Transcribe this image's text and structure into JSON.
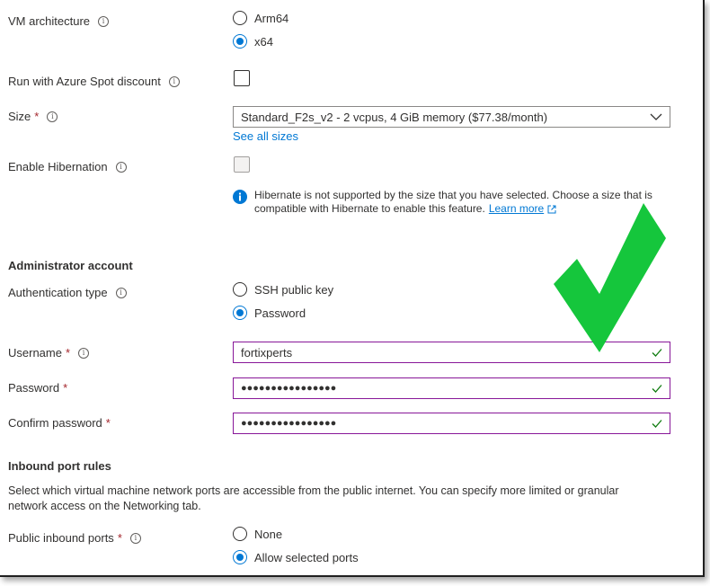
{
  "vm_architecture": {
    "label": "VM architecture",
    "options": [
      "Arm64",
      "x64"
    ],
    "selected": "x64"
  },
  "spot": {
    "label": "Run with Azure Spot discount",
    "checked": false
  },
  "size": {
    "label": "Size",
    "required_mark": "*",
    "value": "Standard_F2s_v2 - 2 vcpus, 4 GiB memory ($77.38/month)",
    "see_all_link": "See all sizes"
  },
  "hibernation": {
    "label": "Enable Hibernation",
    "checked": false,
    "disabled": true,
    "note_line1": "Hibernate is not supported by the size that you have selected. Choose a size that is",
    "note_line2": "compatible with Hibernate to enable this feature.",
    "learn_more": "Learn more"
  },
  "admin": {
    "heading": "Administrator account",
    "auth_label": "Authentication type",
    "auth_options": [
      "SSH public key",
      "Password"
    ],
    "auth_selected": "Password",
    "username_label": "Username",
    "username_value": "fortixperts",
    "password_label": "Password",
    "password_value": "●●●●●●●●●●●●●●●●",
    "confirm_label": "Confirm password",
    "confirm_value": "●●●●●●●●●●●●●●●●",
    "required_mark": "*"
  },
  "inbound": {
    "heading": "Inbound port rules",
    "description_line1": "Select which virtual machine network ports are accessible from the public internet. You can specify more limited or granular",
    "description_line2": "network access on the Networking tab.",
    "public_ports_label": "Public inbound ports",
    "options": [
      "None",
      "Allow selected ports"
    ],
    "selected": "Allow selected ports"
  },
  "colors": {
    "accent": "#0078d4",
    "valid_border": "#881798",
    "valid_check": "#107c10",
    "overlay_check": "#15c63c",
    "required": "#a4262c"
  },
  "icons": {
    "info": "info-icon",
    "chevron": "chevron-down-icon",
    "valid": "checkmark-icon",
    "external": "external-link-icon",
    "overlay": "big-green-checkmark"
  }
}
